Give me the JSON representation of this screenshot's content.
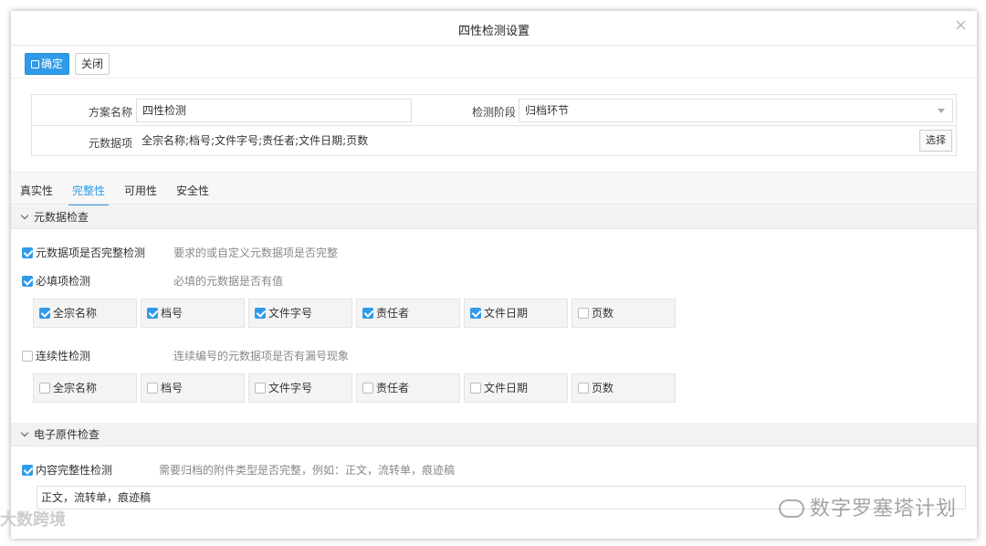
{
  "dialog": {
    "title": "四性检测设置",
    "close_glyph": "×"
  },
  "toolbar": {
    "confirm_label": "确定",
    "close_label": "关闭"
  },
  "form": {
    "scheme_label": "方案名称",
    "scheme_value": "四性检测",
    "stage_label": "检测阶段",
    "stage_value": "归档环节",
    "metadata_label": "元数据项",
    "metadata_value": "全宗名称;档号;文件字号;责任者;文件日期;页数",
    "choose_label": "选择"
  },
  "tabs": [
    "真实性",
    "完整性",
    "可用性",
    "安全性"
  ],
  "active_tab": "完整性",
  "section1": {
    "title": "元数据检查",
    "check1": {
      "label": "元数据项是否完整检测",
      "hint": "要求的或自定义元数据项是否完整",
      "checked": true
    },
    "check2": {
      "label": "必填项检测",
      "hint": "必填的元数据是否有值",
      "checked": true
    },
    "required_fields": [
      {
        "label": "全宗名称",
        "checked": true
      },
      {
        "label": "档号",
        "checked": true
      },
      {
        "label": "文件字号",
        "checked": true
      },
      {
        "label": "责任者",
        "checked": true
      },
      {
        "label": "文件日期",
        "checked": true
      },
      {
        "label": "页数",
        "checked": false
      }
    ],
    "check3": {
      "label": "连续性检测",
      "hint": "连续编号的元数据项是否有漏号现象",
      "checked": false
    },
    "continuity_fields": [
      {
        "label": "全宗名称",
        "checked": false
      },
      {
        "label": "档号",
        "checked": false
      },
      {
        "label": "文件字号",
        "checked": false
      },
      {
        "label": "责任者",
        "checked": false
      },
      {
        "label": "文件日期",
        "checked": false
      },
      {
        "label": "页数",
        "checked": false
      }
    ]
  },
  "section2": {
    "title": "电子原件检查",
    "check1": {
      "label": "内容完整性检测",
      "hint": "需要归档的附件类型是否完整，例如：正文，流转单，痕迹稿",
      "checked": true
    },
    "types_value": "正文，流转单，痕迹稿"
  },
  "watermark": {
    "text": "数字罗塞塔计划",
    "text2": "大数跨境"
  },
  "colors": {
    "accent": "#2f9be8"
  }
}
